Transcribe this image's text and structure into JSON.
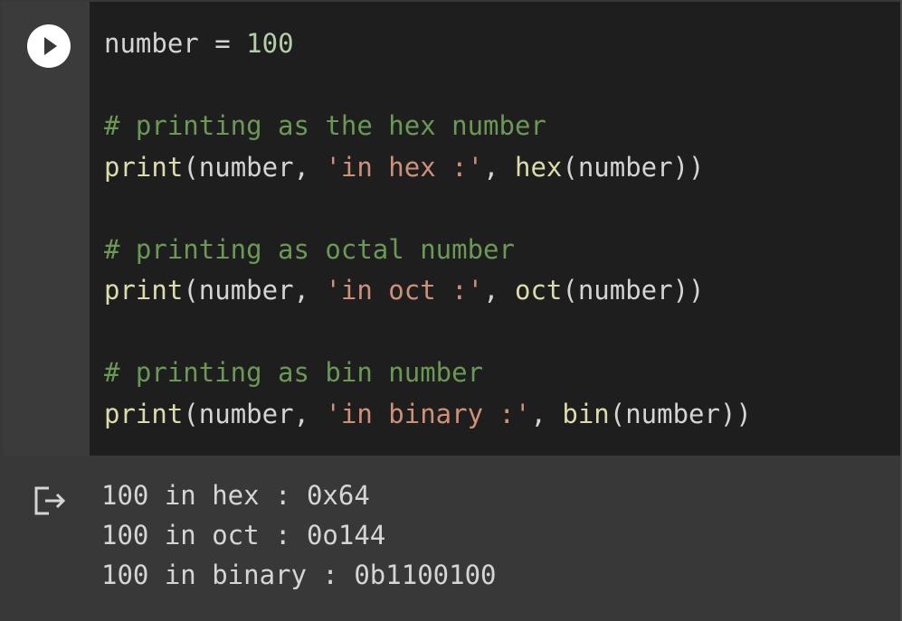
{
  "code": {
    "line1": {
      "var": "number",
      "op": " = ",
      "num": "100"
    },
    "line3": {
      "comment": "# printing as the hex number"
    },
    "line4": {
      "fn": "print",
      "open": "(number, ",
      "str": "'in hex :'",
      "sep": ", ",
      "fn2": "hex",
      "close": "(number))"
    },
    "line6": {
      "comment": "# printing as octal number"
    },
    "line7": {
      "fn": "print",
      "open": "(number, ",
      "str": "'in oct :'",
      "sep": ", ",
      "fn2": "oct",
      "close": "(number))"
    },
    "line9": {
      "comment": "# printing as bin number"
    },
    "line10": {
      "fn": "print",
      "open": "(number, ",
      "str": "'in binary :'",
      "sep": ", ",
      "fn2": "bin",
      "close": "(number))"
    }
  },
  "output": {
    "lines": [
      "100 in hex : 0x64",
      "100 in oct : 0o144",
      "100 in binary : 0b1100100"
    ]
  },
  "icons": {
    "run": "play-icon",
    "output": "output-clear-icon"
  },
  "colors": {
    "editor_bg": "#1e1e1e",
    "gutter_bg": "#3b3b3b",
    "output_bg": "#383838",
    "comment": "#6a9955",
    "function": "#dcdcaa",
    "string": "#ce9178",
    "number": "#b5cea8",
    "text": "#d4d4d4"
  }
}
